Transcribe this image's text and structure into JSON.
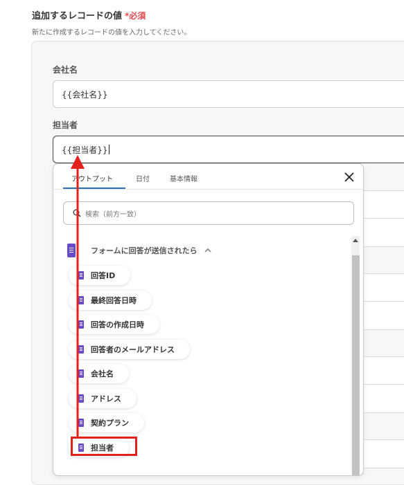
{
  "section": {
    "title": "追加するレコードの値",
    "required_mark": "*",
    "required_label": "必須",
    "description": "新たに作成するレコードの値を入力してください。"
  },
  "fields": [
    {
      "label": "会社名",
      "value": "{{会社名}}"
    },
    {
      "label": "担当者",
      "value": "{{担当者}}"
    }
  ],
  "popup": {
    "tabs": [
      "アウトプット",
      "日付",
      "基本情報"
    ],
    "active_tab": "アウトプット",
    "search_placeholder": "検索（前方一致）",
    "group": {
      "label": "フォームに回答が送信されたら",
      "icon": "google-forms-icon"
    },
    "items": [
      "回答ID",
      "最終回答日時",
      "回答の作成日時",
      "回答者のメールアドレス",
      "会社名",
      "アドレス",
      "契約プラン",
      "担当者"
    ],
    "highlighted_item": "担当者"
  },
  "colors": {
    "required": "#e5484d",
    "tab_underline": "#2a6fb6",
    "forms_icon": "#6b49c8",
    "annotation": "#e2201c"
  }
}
